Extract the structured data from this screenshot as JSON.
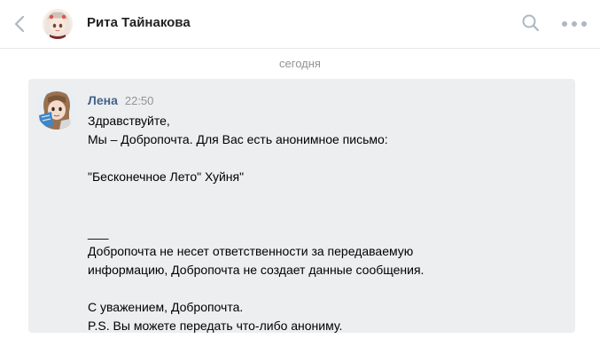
{
  "header": {
    "peer_name": "Рита Тайнакова"
  },
  "date_separator": "сегодня",
  "message": {
    "sender": "Лена",
    "time": "22:50",
    "lines": [
      "Здравствуйте,",
      "Мы – Добропочта. Для Вас есть анонимное письмо:",
      "",
      "\"Бесконечное Лето\" Хуйня\"",
      "",
      "",
      "___",
      "Добропочта не несет ответственности за передаваемую",
      "информацию, Добропочта не создает данные сообщения.",
      "",
      "С уважением, Добропочта.",
      "P.S. Вы можете передать что-либо анониму."
    ]
  },
  "icons": {
    "back": "chevron-left-icon",
    "search": "search-icon",
    "more": "more-dots-icon"
  },
  "colors": {
    "accent_link": "#42648b",
    "message_bg": "#edeef0",
    "muted_text": "#939393",
    "icon_gray": "#aeb7c2"
  }
}
